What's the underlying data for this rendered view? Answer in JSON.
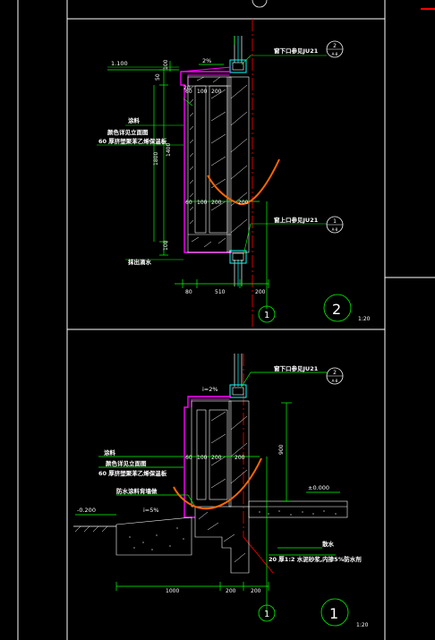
{
  "drawing": {
    "colors": {
      "background": "#000000",
      "frame": "#ffffff",
      "dimension": "#00ff00",
      "wall": "#ff00ff",
      "hatch": "#ffffff",
      "leader": "#00ff00",
      "markup": "#ff6600",
      "axis": "#ff0000",
      "window": "#00ffff"
    },
    "top_detail": {
      "elevation": "1.100",
      "slope": "2%",
      "note_paint": "涂料",
      "note_color": "颜色详见立面图",
      "note_insulation": "60 厚挤塑聚苯乙烯保温板",
      "note_drip": "抹出滴水",
      "window_below_ref": "窗下口参见JU21",
      "window_above_ref": "窗上口参见JU21",
      "bubble_top_num": "2",
      "bubble_top_sub": "A-8",
      "bubble_bot_num": "1",
      "bubble_bot_sub": "A-8",
      "dims_row": [
        "60",
        "100",
        "200"
      ],
      "dims_bottom": [
        "80",
        "510",
        "200"
      ],
      "dim_height": "1400",
      "dim_h2": "1800",
      "dim_small": [
        "100",
        "100",
        "50",
        "20"
      ],
      "axis_num": "1",
      "detail_num": "2",
      "scale": "1:20"
    },
    "bottom_detail": {
      "slope": "i=2%",
      "note_paint": "涂料",
      "note_color": "颜色详见立面图",
      "note_insulation": "60 厚挤塑聚苯乙烯保温板",
      "note_waterproof": "防水涂料背墙做",
      "window_below_ref": "窗下口参见JU21",
      "bubble_num": "2",
      "bubble_sub": "A-8",
      "elev_left": "-0.200",
      "elev_right": "±0.000",
      "slope_left": "i=5%",
      "dim_vertical": "900",
      "dims_row": [
        "60",
        "100",
        "200"
      ],
      "dims_bottom": [
        "1000",
        "200",
        "200"
      ],
      "note_sand": "散水",
      "note_mortar": "20 厚1:2 水泥砂浆,内掺5%防水剂",
      "axis_num": "1",
      "detail_num": "1",
      "scale": "1:20"
    }
  }
}
